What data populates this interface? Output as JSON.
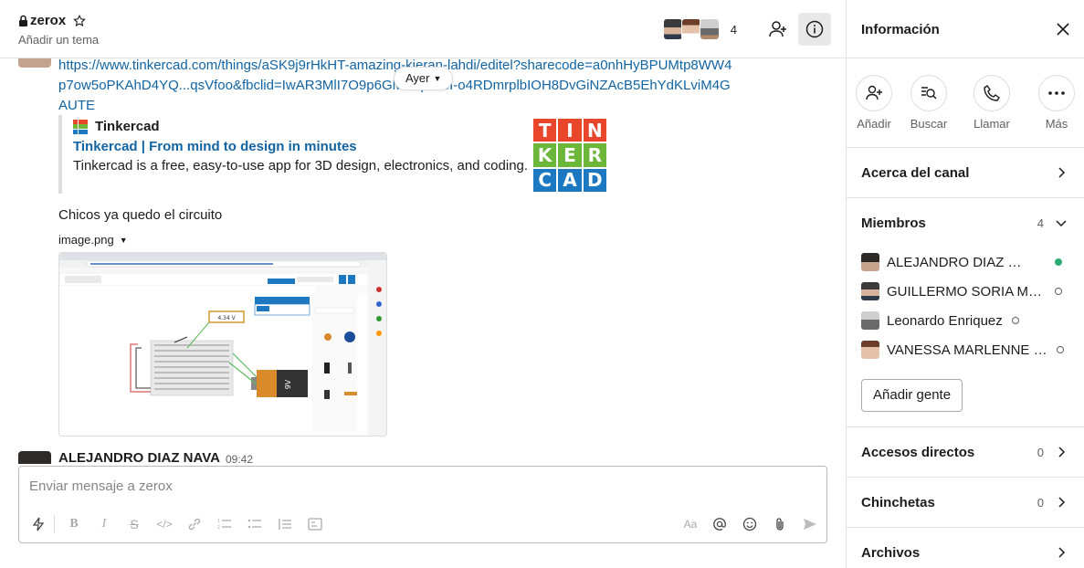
{
  "channel": {
    "name": "zerox",
    "topic": "Añadir un tema",
    "member_count": "4"
  },
  "messages": {
    "link_url": "https://www.tinkercad.com/things/aSK9j9rHkHT-amazing-kieran-lahdi/editel?sharecode=a0nhHyBPUMtp8WW4p7ow5oPKAhD4YQ...qsVfoo&fbclid=IwAR3MlI7O9p6GMzwp-V8I-o4RDmrplbIOH8DvGiNZAcB5EhYdKLviM4GAUTE",
    "date_divider": "Ayer",
    "unfurl": {
      "site": "Tinkercad",
      "title": "Tinkercad | From mind to design in minutes",
      "description": "Tinkercad is a free, easy-to-use app for 3D design, electronics, and coding.",
      "logo_letters": [
        "T",
        "I",
        "N",
        "K",
        "E",
        "R",
        "C",
        "A",
        "D"
      ],
      "logo_colors": [
        "#e8472c",
        "#e8472c",
        "#e8472c",
        "#6cb63a",
        "#6cb63a",
        "#6cb63a",
        "#1c78c0",
        "#1c78c0",
        "#1c78c0"
      ]
    },
    "text": "Chicos ya quedo el circuito",
    "file_name": "image.png",
    "image_preview": {
      "voltage_reading": "4.34 V",
      "battery_label": "9V"
    },
    "next_author": "ALEJANDRO DIAZ NAVA",
    "next_time": "09:42"
  },
  "composer": {
    "placeholder": "Enviar mensaje a zerox",
    "tools": [
      "lightning-icon",
      "bold-icon",
      "italic-icon",
      "strike-icon",
      "code-icon",
      "link-icon",
      "ordered-list-icon",
      "bullet-list-icon",
      "quote-icon",
      "code-block-icon",
      "format-icon",
      "mention-icon",
      "emoji-icon",
      "attach-icon",
      "send-icon"
    ],
    "format_label": "Aa"
  },
  "panel": {
    "title": "Información",
    "actions": [
      {
        "label": "Añadir",
        "icon": "add-person-icon"
      },
      {
        "label": "Buscar",
        "icon": "search-icon"
      },
      {
        "label": "Llamar",
        "icon": "phone-icon"
      },
      {
        "label": "Más",
        "icon": "more-icon"
      }
    ],
    "about": "Acerca del canal",
    "members_label": "Miembros",
    "members_count": "4",
    "members": [
      {
        "name": "ALEJANDRO DIAZ NAVA",
        "online": true
      },
      {
        "name": "GUILLERMO SORIA MARTINEZ",
        "online": false
      },
      {
        "name": "Leonardo Enriquez",
        "online": false
      },
      {
        "name": "VANESSA MARLENNE RAMIREZ",
        "online": false
      }
    ],
    "add_people": "Añadir gente",
    "shortcuts_label": "Accesos directos",
    "shortcuts_count": "0",
    "pins_label": "Chinchetas",
    "pins_count": "0",
    "files_label": "Archivos"
  },
  "colors": {
    "link": "#1264a3",
    "presence_online": "#2bac76"
  }
}
